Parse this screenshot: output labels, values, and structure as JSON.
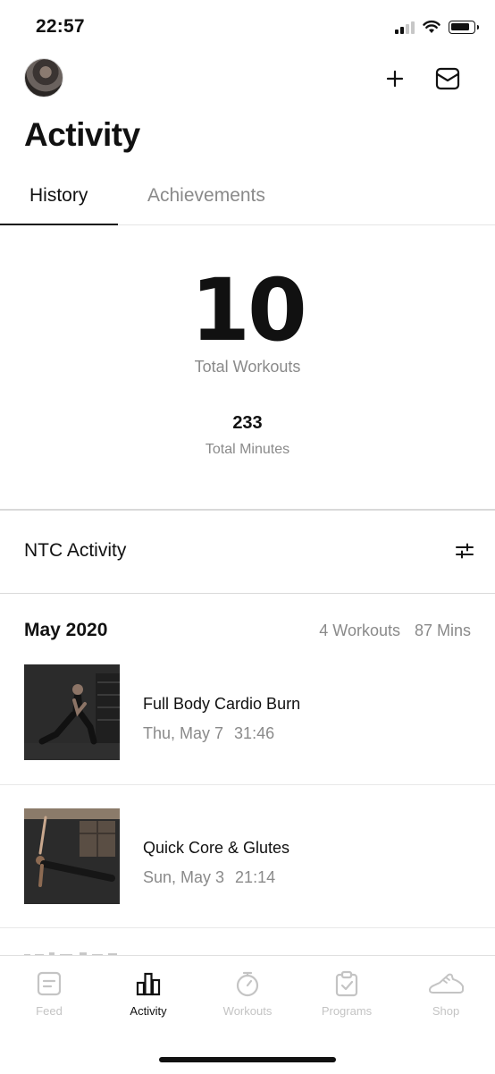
{
  "status_bar": {
    "time": "22:57"
  },
  "header": {
    "title": "Activity"
  },
  "tabs": [
    {
      "label": "History",
      "active": true
    },
    {
      "label": "Achievements",
      "active": false
    }
  ],
  "summary": {
    "total_workouts": "10",
    "total_workouts_label": "Total Workouts",
    "total_minutes": "233",
    "total_minutes_label": "Total Minutes"
  },
  "ntc_section": {
    "label": "NTC Activity"
  },
  "month": {
    "title": "May 2020",
    "workouts_count": "4 Workouts",
    "minutes": "87 Mins"
  },
  "workouts": [
    {
      "name": "Full Body Cardio Burn",
      "date": "Thu, May 7",
      "duration": "31:46",
      "thumbnail_icon": "workout-photo-lunge"
    },
    {
      "name": "Quick Core & Glutes",
      "date": "Sun, May 3",
      "duration": "21:14",
      "thumbnail_icon": "workout-photo-side-plank"
    }
  ],
  "bottom_nav": [
    {
      "label": "Feed",
      "icon": "feed-icon",
      "active": false
    },
    {
      "label": "Activity",
      "icon": "activity-bars-icon",
      "active": true
    },
    {
      "label": "Workouts",
      "icon": "stopwatch-icon",
      "active": false
    },
    {
      "label": "Programs",
      "icon": "clipboard-check-icon",
      "active": false
    },
    {
      "label": "Shop",
      "icon": "shoe-icon",
      "active": false
    }
  ],
  "colors": {
    "text_primary": "#111111",
    "text_secondary": "#8a8a8a",
    "nav_inactive": "#c4c4c4",
    "divider": "#d9d9d9"
  }
}
